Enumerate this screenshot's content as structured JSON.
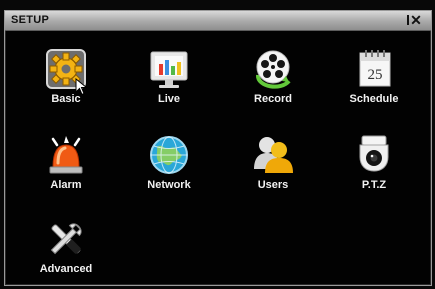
{
  "window": {
    "title": "SETUP",
    "close_icon": "close-icon"
  },
  "menu": {
    "items": [
      {
        "id": "basic",
        "label": "Basic",
        "icon": "gear-icon"
      },
      {
        "id": "live",
        "label": "Live",
        "icon": "monitor-chart-icon"
      },
      {
        "id": "record",
        "label": "Record",
        "icon": "film-reel-icon"
      },
      {
        "id": "schedule",
        "label": "Schedule",
        "icon": "calendar-icon",
        "icon_text": "25"
      },
      {
        "id": "alarm",
        "label": "Alarm",
        "icon": "alarm-siren-icon"
      },
      {
        "id": "network",
        "label": "Network",
        "icon": "globe-icon"
      },
      {
        "id": "users",
        "label": "Users",
        "icon": "users-icon"
      },
      {
        "id": "ptz",
        "label": "P.T.Z",
        "icon": "dome-camera-icon"
      },
      {
        "id": "advanced",
        "label": "Advanced",
        "icon": "tools-icon"
      }
    ]
  },
  "colors": {
    "background": "#020202",
    "label_text": "#f2f2f2",
    "titlebar": "#b5b5b5"
  }
}
